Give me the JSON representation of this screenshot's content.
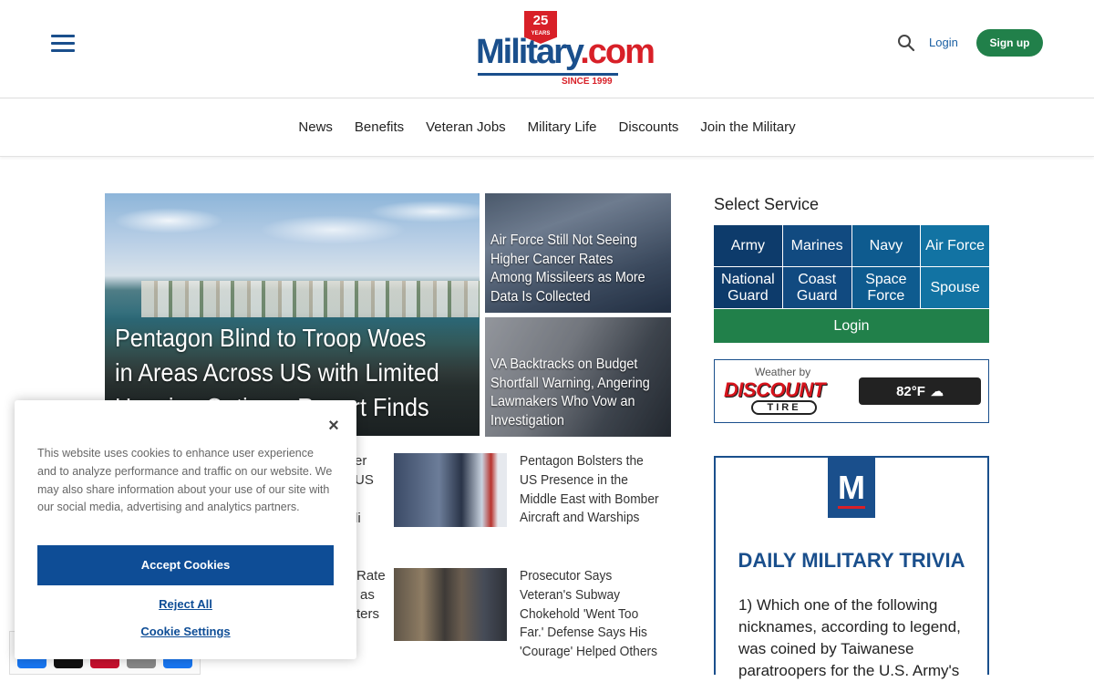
{
  "header": {
    "logo": {
      "badge_number": "25",
      "badge_small": "YEARS",
      "wordmark": "Military",
      "dot_com": ".com",
      "since": "SINCE 1999"
    },
    "login_label": "Login",
    "signup_label": "Sign up"
  },
  "nav": {
    "items": [
      {
        "label": "News"
      },
      {
        "label": "Benefits"
      },
      {
        "label": "Veteran Jobs"
      },
      {
        "label": "Military Life"
      },
      {
        "label": "Discounts"
      },
      {
        "label": "Join the Military"
      }
    ]
  },
  "hero": {
    "title": "Pentagon Blind to Troop Woes in Areas Across US with Limited Housing Options, Report Finds"
  },
  "side_stories": [
    {
      "title": "Air Force Still Not Seeing Higher Cancer Rates Among Missileers as More Data Is Collected"
    },
    {
      "title": "VA Backtracks on Budget Shortfall Warning, Angering Lawmakers Who Vow an Investigation"
    }
  ],
  "articles": [
    {
      "title": "Pentagon Bolsters the US Presence in the Middle East with Bomber Aircraft and Warships"
    },
    {
      "title": "Prosecutor Says Veteran's Subway Chokehold 'Went Too Far.' Defense Says His 'Courage' Helped Others"
    }
  ],
  "partial_left": {
    "line1": "er",
    "line2": "US",
    "line3": "li",
    "line4": "Rate",
    "line5": "as",
    "line6": "ters"
  },
  "sidebar": {
    "select_title": "Select Service",
    "services": [
      {
        "label": "Army",
        "color": "#0d3b6b"
      },
      {
        "label": "Marines",
        "color": "#114a80"
      },
      {
        "label": "Navy",
        "color": "#0e5b8f"
      },
      {
        "label": "Air Force",
        "color": "#1273a3"
      },
      {
        "label": "National Guard",
        "color": "#0d3b6b"
      },
      {
        "label": "Coast Guard",
        "color": "#114a80"
      },
      {
        "label": "Space Force",
        "color": "#0e5b8f"
      },
      {
        "label": "Spouse",
        "color": "#1273a3"
      }
    ],
    "login_label": "Login",
    "weather": {
      "by": "Weather by",
      "brand": "DISCOUNT",
      "brand_sub": "TIRE",
      "temperature": "82°F"
    },
    "trivia": {
      "logo_letter": "M",
      "title": "DAILY MILITARY TRIVIA",
      "question": "1) Which one of the following nicknames, according to legend, was coined by Taiwanese paratroopers for the U.S. Army's"
    }
  },
  "cookie": {
    "text": "This website uses cookies to enhance user experience and to analyze performance and traffic on our website. We may also share information about your use of our site with our social media, advertising and analytics partners.",
    "accept_label": "Accept Cookies",
    "reject_label": "Reject All",
    "settings_label": "Cookie Settings",
    "close_label": "×"
  },
  "share": {
    "buttons": [
      {
        "icon": "facebook-icon",
        "color": "#1877f2"
      },
      {
        "icon": "x-icon",
        "color": "#111111"
      },
      {
        "icon": "pinterest-icon",
        "color": "#c8102e"
      },
      {
        "icon": "email-icon",
        "color": "#888888"
      },
      {
        "icon": "share-icon",
        "color": "#1877f2"
      }
    ]
  }
}
